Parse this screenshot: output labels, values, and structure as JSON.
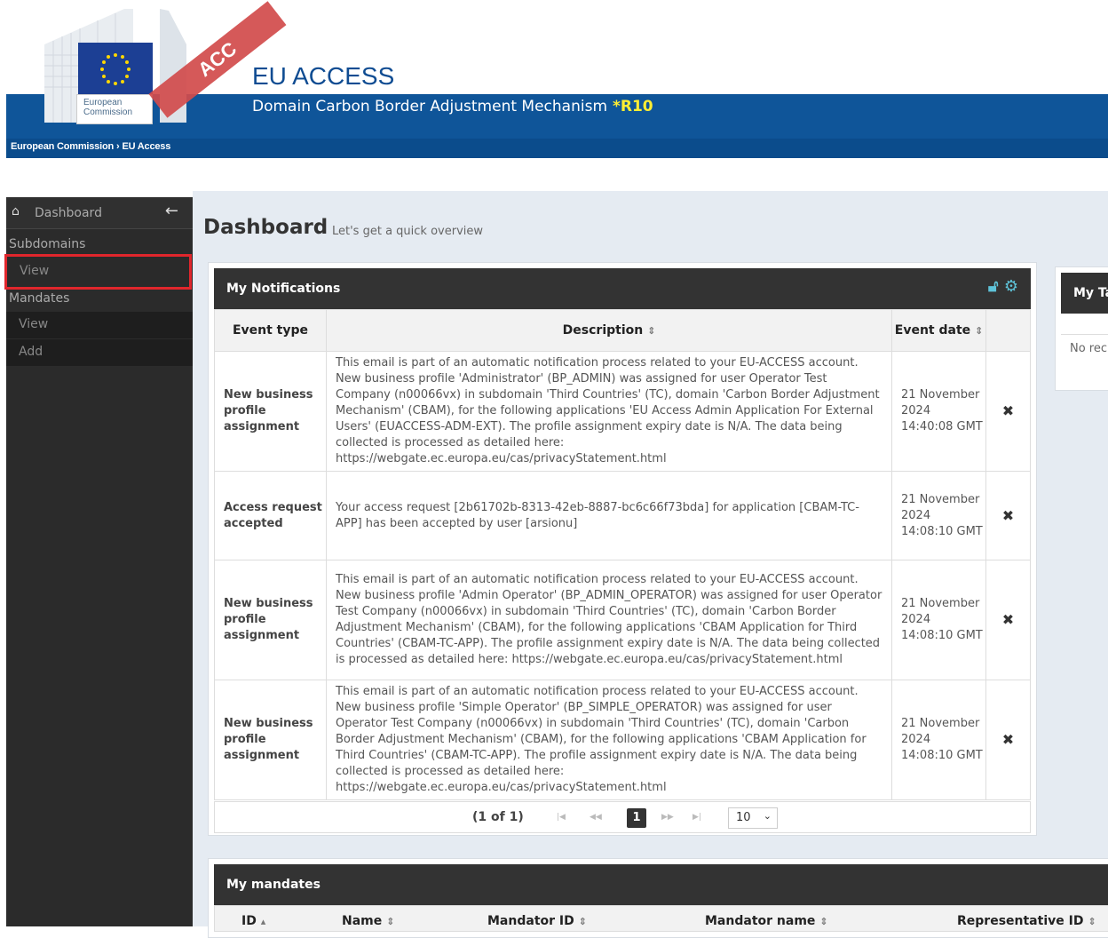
{
  "header": {
    "app_title": "EU ACCESS",
    "app_subtitle": "Domain Carbon Border Adjustment Mechanism",
    "release": "*R10",
    "env_badge": "ACC",
    "logo_line1": "European",
    "logo_line2": "Commission",
    "breadcrumb": [
      "European Commission",
      "EU Access"
    ],
    "breadcrumb_separator": "›"
  },
  "sidebar": {
    "dashboard_label": "Dashboard",
    "sections": [
      {
        "title": "Subdomains",
        "items": [
          "View"
        ]
      },
      {
        "title": "Mandates",
        "items": [
          "View",
          "Add"
        ]
      }
    ]
  },
  "page": {
    "title": "Dashboard",
    "subtitle": "Let's get a quick overview"
  },
  "notifications": {
    "title": "My Notifications",
    "columns": [
      "Event type",
      "Description",
      "Event date"
    ],
    "rows": [
      {
        "type": "New business profile assignment",
        "description": "This email is part of an automatic notification process related to your EU-ACCESS account. New business profile 'Administrator' (BP_ADMIN) was assigned for user Operator Test Company (n00066vx) in subdomain 'Third Countries' (TC), domain 'Carbon Border Adjustment Mechanism' (CBAM), for the following applications 'EU Access Admin Application For External Users' (EUACCESS-ADM-EXT). The profile assignment expiry date is N/A. The data being collected is processed as detailed here: https://webgate.ec.europa.eu/cas/privacyStatement.html",
        "date": "21 November 2024 14:40:08 GMT"
      },
      {
        "type": "Access request accepted",
        "description": "Your access request [2b61702b-8313-42eb-8887-bc6c66f73bda] for application [CBAM-TC-APP] has been accepted by user [arsionu]",
        "date": "21 November 2024 14:08:10 GMT"
      },
      {
        "type": "New business profile assignment",
        "description": "This email is part of an automatic notification process related to your EU-ACCESS account. New business profile 'Admin Operator' (BP_ADMIN_OPERATOR) was assigned for user Operator Test Company (n00066vx) in subdomain 'Third Countries' (TC), domain 'Carbon Border Adjustment Mechanism' (CBAM), for the following applications 'CBAM Application for Third Countries' (CBAM-TC-APP). The profile assignment expiry date is N/A. The data being collected is processed as detailed here: https://webgate.ec.europa.eu/cas/privacyStatement.html",
        "date": "21 November 2024 14:08:10 GMT"
      },
      {
        "type": "New business profile assignment",
        "description": "This email is part of an automatic notification process related to your EU-ACCESS account. New business profile 'Simple Operator' (BP_SIMPLE_OPERATOR) was assigned for user Operator Test Company (n00066vx) in subdomain 'Third Countries' (TC), domain 'Carbon Border Adjustment Mechanism' (CBAM), for the following applications 'CBAM Application for Third Countries' (CBAM-TC-APP). The profile assignment expiry date is N/A. The data being collected is processed as detailed here: https://webgate.ec.europa.eu/cas/privacyStatement.html",
        "date": "21 November 2024 14:08:10 GMT"
      }
    ],
    "pager": {
      "count": "(1 of 1)",
      "current_page": "1",
      "rows_per_page": "10"
    }
  },
  "tasks": {
    "title": "My Ta",
    "empty": "No rec"
  },
  "mandates": {
    "title": "My mandates",
    "columns": [
      "ID",
      "Name",
      "Mandator ID",
      "Mandator name",
      "Representative ID"
    ]
  },
  "colors": {
    "header_blue": "#0f5599",
    "sidebar_bg": "#2b2b2b",
    "highlight_outline": "#e0262c",
    "release_yellow": "#ffee33"
  }
}
